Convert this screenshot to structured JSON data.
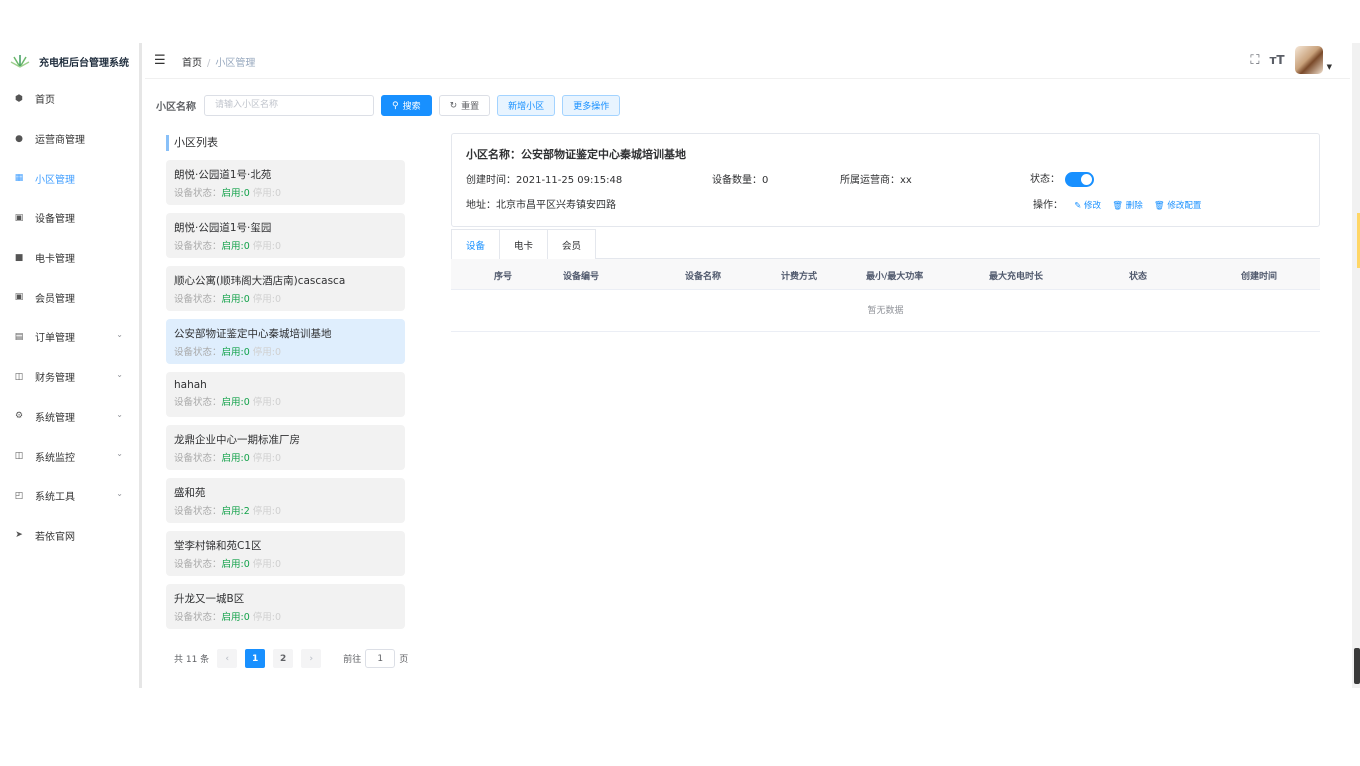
{
  "app": {
    "title": "充电柜后台管理系统"
  },
  "sidebar": {
    "items": [
      {
        "label": "首页",
        "icon": "dashboard-icon",
        "glyph": "⬢"
      },
      {
        "label": "运营商管理",
        "icon": "user-icon",
        "glyph": "●"
      },
      {
        "label": "小区管理",
        "icon": "grid-icon",
        "glyph": "▦"
      },
      {
        "label": "设备管理",
        "icon": "device-icon",
        "glyph": "▣"
      },
      {
        "label": "电卡管理",
        "icon": "card-icon",
        "glyph": "■"
      },
      {
        "label": "会员管理",
        "icon": "member-icon",
        "glyph": "▣"
      },
      {
        "label": "订单管理",
        "icon": "list-icon",
        "glyph": "▤"
      },
      {
        "label": "财务管理",
        "icon": "finance-icon",
        "glyph": "◫"
      },
      {
        "label": "系统管理",
        "icon": "settings-icon",
        "glyph": "⚙"
      },
      {
        "label": "系统监控",
        "icon": "monitor-icon",
        "glyph": "◫"
      },
      {
        "label": "系统工具",
        "icon": "tool-icon",
        "glyph": "◰"
      },
      {
        "label": "若依官网",
        "icon": "send-icon",
        "glyph": "➤"
      }
    ]
  },
  "navbar": {
    "breadcrumb": {
      "home": "首页",
      "sep": "/",
      "current": "小区管理"
    }
  },
  "search": {
    "label": "小区名称",
    "placeholder": "请输入小区名称",
    "search_btn": "搜索",
    "reset_btn": "重置",
    "add_btn": "新增小区",
    "more_btn": "更多操作"
  },
  "list": {
    "title": "小区列表",
    "status_label": "设备状态：",
    "on_label": "启用:",
    "off_label": "停用:",
    "items": [
      {
        "name": "朗悦·公园道1号·北苑",
        "on": "0",
        "off": "0"
      },
      {
        "name": "朗悦·公园道1号·玺园",
        "on": "0",
        "off": "0"
      },
      {
        "name": "顺心公寓(顺玮阁大酒店南)cascasca",
        "on": "0",
        "off": "0"
      },
      {
        "name": "公安部物证鉴定中心秦城培训基地",
        "on": "0",
        "off": "0"
      },
      {
        "name": "hahah",
        "on": "0",
        "off": "0"
      },
      {
        "name": "龙鼎企业中心一期标准厂房",
        "on": "0",
        "off": "0"
      },
      {
        "name": "盛和苑",
        "on": "2",
        "off": "0"
      },
      {
        "name": "堂李村锦和苑C1区",
        "on": "0",
        "off": "0"
      },
      {
        "name": "升龙又一城B区",
        "on": "0",
        "off": "0"
      }
    ]
  },
  "pager": {
    "total": "共 11 条",
    "prev": "‹",
    "next": "›",
    "pages": [
      "1",
      "2"
    ],
    "goto": "前往",
    "goto_value": "1",
    "page_unit": "页"
  },
  "detail": {
    "name": "小区名称：公安部物证鉴定中心秦城培训基地",
    "created": "创建时间：2021-11-25 09:15:48",
    "device_count": "设备数量：0",
    "operator": "所属运营商：xx",
    "status_label": "状态：",
    "status_on": true,
    "address": "地址：北京市昌平区兴寿镇安四路",
    "ops_label": "操作：",
    "op_edit": "修改",
    "op_delete": "删除",
    "op_config": "修改配置"
  },
  "tabs": [
    "设备",
    "电卡",
    "会员"
  ],
  "table": {
    "columns": [
      "序号",
      "设备编号",
      "设备名称",
      "计费方式",
      "最小/最大功率",
      "最大充电时长",
      "状态",
      "创建时间"
    ],
    "empty": "暂无数据"
  },
  "colors": {
    "primary": "#1890ff",
    "enabled": "#13a24a"
  }
}
